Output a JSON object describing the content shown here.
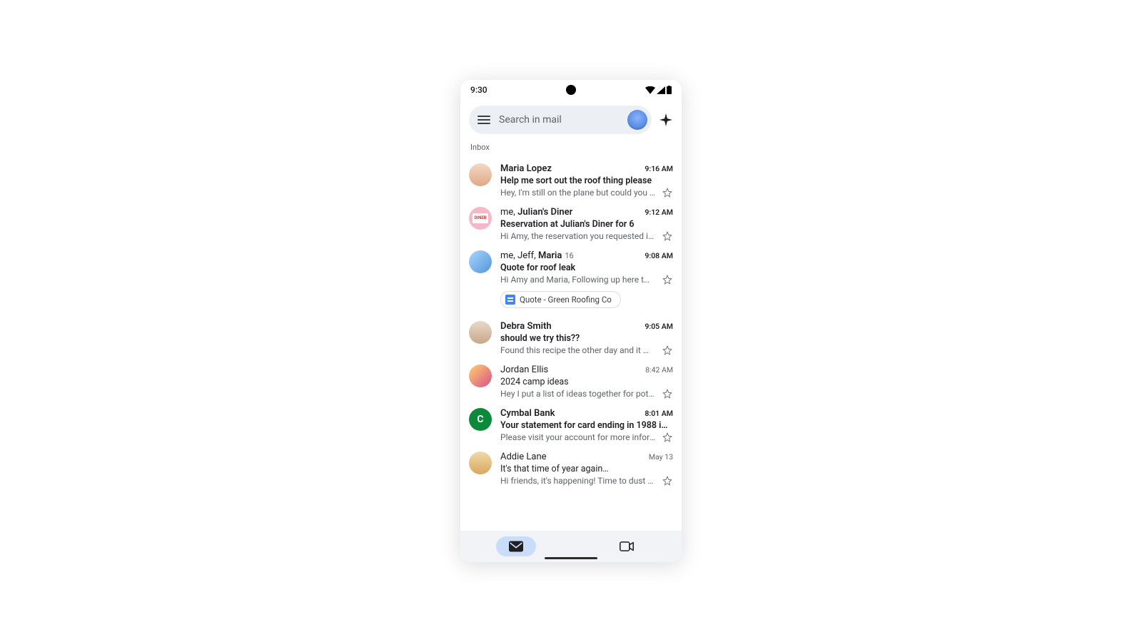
{
  "statusbar": {
    "time": "9:30"
  },
  "search": {
    "placeholder": "Search in mail"
  },
  "section": {
    "label": "Inbox"
  },
  "emails": [
    {
      "sender": "Maria Lopez",
      "time": "9:16 AM",
      "subject": "Help me sort out the roof thing please",
      "snippet": "Hey, I'm still on the plane but could you repl…",
      "unread": true
    },
    {
      "sender_prefix": "me, ",
      "sender": "Julian's Diner",
      "time": "9:12 AM",
      "subject": "Reservation at Julian's Diner for 6",
      "snippet": "Hi Amy, the reservation you requested is now",
      "unread": true
    },
    {
      "sender_prefix": "me, Jeff, ",
      "sender": "Maria",
      "thread_count": "16",
      "time": "9:08 AM",
      "subject": "Quote for roof leak",
      "snippet": "Hi Amy and Maria, Following up here t…",
      "attachment": "Quote - Green Roofing Co",
      "unread": true
    },
    {
      "sender": "Debra Smith",
      "time": "9:05 AM",
      "subject": "should we try this??",
      "snippet": "Found this recipe the other day and it might…",
      "unread": true
    },
    {
      "sender": "Jordan Ellis",
      "time": "8:42 AM",
      "subject": "2024 camp ideas",
      "snippet": "Hey I put a list of ideas together for potenti…",
      "unread": false
    },
    {
      "sender": "Cymbal Bank",
      "time": "8:01 AM",
      "subject": "Your statement for card ending in 1988 i…",
      "snippet": "Please visit your account for more informati…",
      "unread": true
    },
    {
      "sender": "Addie Lane",
      "time": "May 13",
      "subject": "It's that time of year again…",
      "snippet": "Hi friends, it's happening! Time to dust off y…",
      "unread": false
    }
  ],
  "avatar_labels": {
    "diner": "DINER",
    "cymbal": "C"
  }
}
